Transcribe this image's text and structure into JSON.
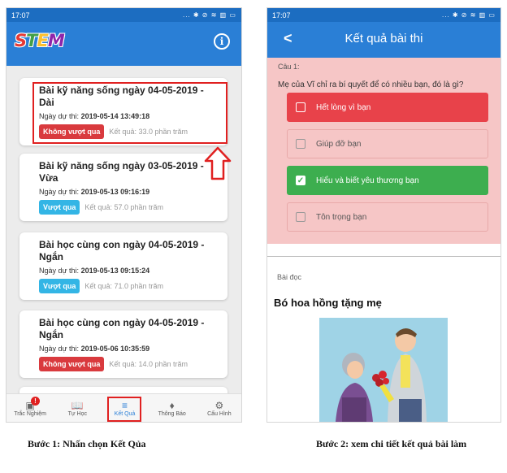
{
  "phone1": {
    "status_time": "17:07",
    "status_icons": "... ✱ ⊘ ≋ ▥ ▭",
    "logo_letters": [
      "S",
      "T",
      "E",
      "M"
    ],
    "logo_colors": [
      "#e53935",
      "#43a047",
      "#fbc02d",
      "#8e24aa"
    ],
    "info_icon": "i",
    "cards": [
      {
        "title": "Bài kỹ năng sống ngày 04-05-2019 - Dài",
        "date_label": "Ngày dự thi:",
        "date": "2019-05-14 13:49:18",
        "status": "Không vượt qua",
        "status_type": "fail",
        "score": "Kết quả: 33.0 phần trăm"
      },
      {
        "title": "Bài kỹ năng sống ngày 03-05-2019 - Vừa",
        "date_label": "Ngày dự thi:",
        "date": "2019-05-13 09:16:19",
        "status": "Vượt qua",
        "status_type": "pass",
        "score": "Kết quả: 57.0 phần trăm"
      },
      {
        "title": "Bài học cùng con ngày 04-05-2019 - Ngắn",
        "date_label": "Ngày dự thi:",
        "date": "2019-05-13 09:15:24",
        "status": "Vượt qua",
        "status_type": "pass",
        "score": "Kết quả: 71.0 phần trăm"
      },
      {
        "title": "Bài học cùng con ngày 04-05-2019 - Ngắn",
        "date_label": "Ngày dự thi:",
        "date": "2019-05-06 10:35:59",
        "status": "Không vượt qua",
        "status_type": "fail",
        "score": "Kết quả: 14.0 phần trăm"
      }
    ],
    "nav": [
      {
        "label": "Trắc Nghiệm",
        "icon": "quiz-icon",
        "badge": "!"
      },
      {
        "label": "Tự Học",
        "icon": "book-icon"
      },
      {
        "label": "Kết Quả",
        "icon": "result-icon",
        "active": true
      },
      {
        "label": "Thông Báo",
        "icon": "bell-icon"
      },
      {
        "label": "Cấu Hình",
        "icon": "gear-icon"
      }
    ]
  },
  "phone2": {
    "status_time": "17:07",
    "status_icons": "... ✱ ⊘ ≋ ▥ ▭",
    "back_icon": "<",
    "title": "Kết quả bài thi",
    "question_label": "Câu 1:",
    "question_text": "Mẹ của Vĩ chỉ ra bí quyết để có nhiều bạn, đó là gì?",
    "options": [
      {
        "text": "Hết lòng vì bạn",
        "state": "wrong"
      },
      {
        "text": "Giúp đỡ bạn",
        "state": "none"
      },
      {
        "text": "Hiểu và biết yêu thương bạn",
        "state": "correct"
      },
      {
        "text": "Tôn trọng bạn",
        "state": "none"
      }
    ],
    "reading_label": "Bài đọc",
    "story_title": "Bó hoa hồng tặng mẹ"
  },
  "captions": {
    "step1": "Bước 1: Nhấn chọn Kết Qủa",
    "step2": "Bước 2: xem chi tiết kết quả bài làm"
  },
  "colors": {
    "header_blue": "#2a7fd6",
    "fail_red": "#d93a3e",
    "pass_blue": "#33b5e5",
    "correct_green": "#3dae4f",
    "quiz_bg": "#f6c6c6",
    "highlight_red": "#e02020"
  }
}
